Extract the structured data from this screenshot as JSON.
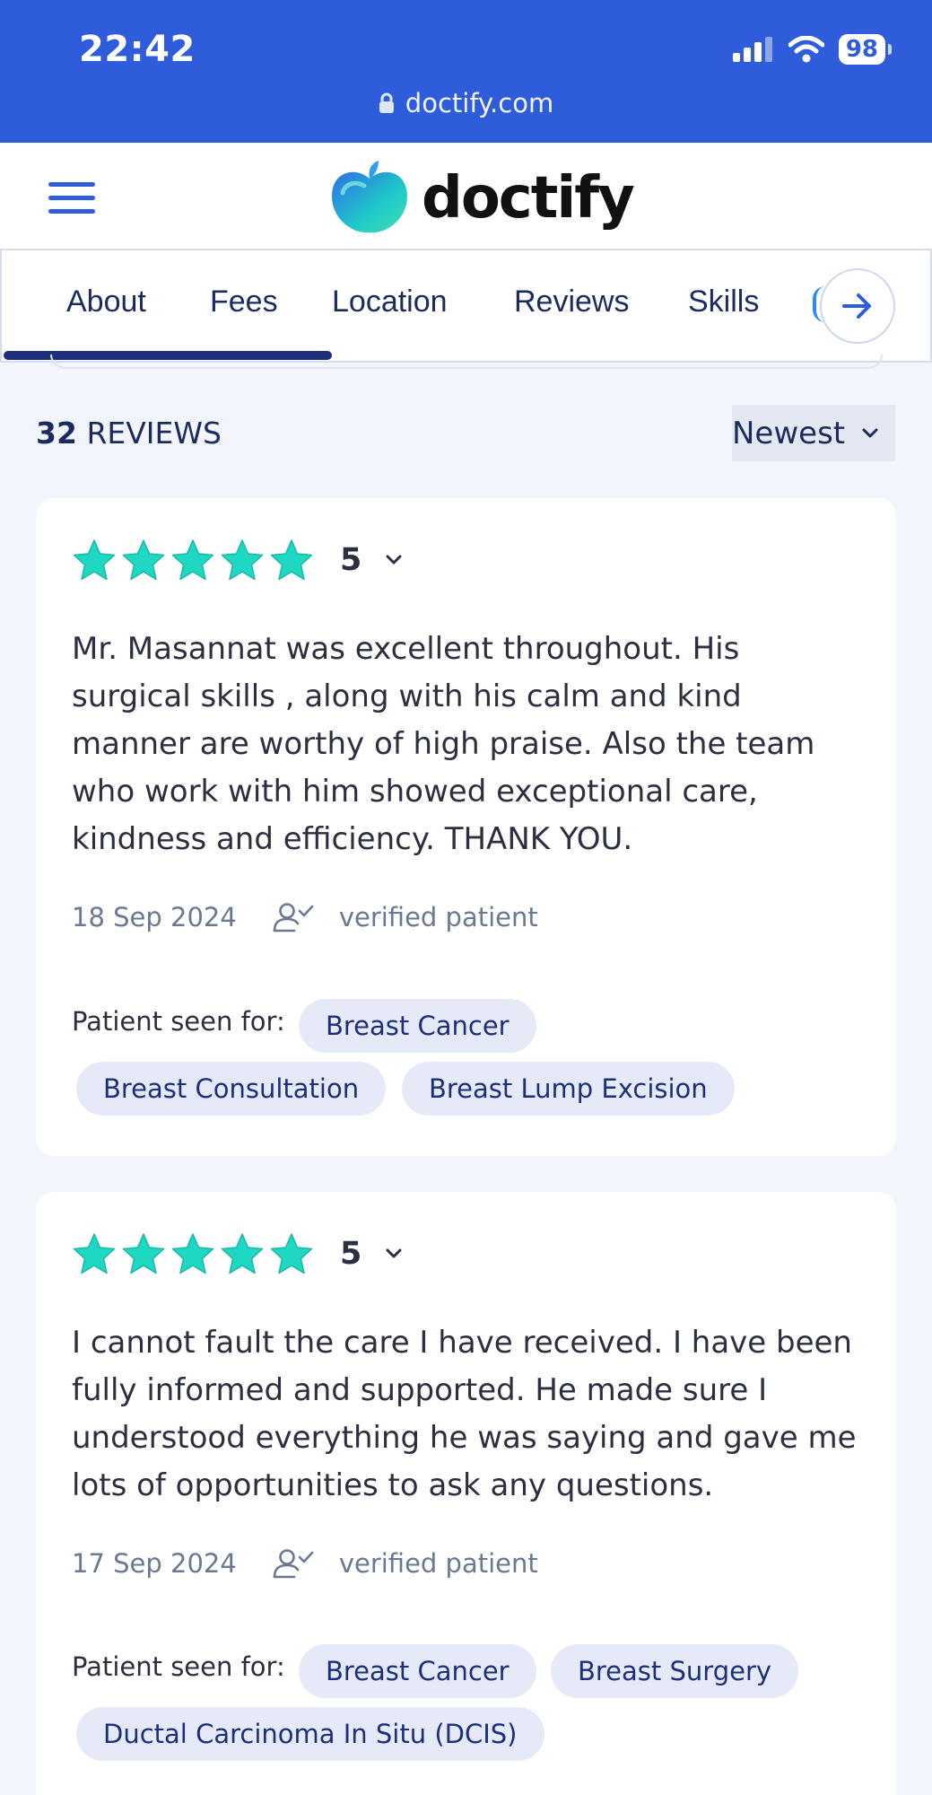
{
  "status_bar": {
    "time": "22:42",
    "battery": "98",
    "url": "doctify.com"
  },
  "header": {
    "brand": "doctify"
  },
  "tabs": [
    {
      "label": "About"
    },
    {
      "label": "Fees"
    },
    {
      "label": "Location"
    },
    {
      "label": "Reviews"
    },
    {
      "label": "Skills"
    }
  ],
  "reviews_header": {
    "count": "32",
    "label": "REVIEWS",
    "sort": "Newest"
  },
  "reviews": [
    {
      "rating": "5",
      "text": "Mr. Masannat was excellent throughout. His surgical skills , along with his calm and kind manner are worthy of high praise. Also the team who work with him showed exceptional care, kindness and efficiency. THANK YOU.",
      "date": "18 Sep 2024",
      "verified": "verified patient",
      "seen_for_label": "Patient seen for:",
      "tags": [
        "Breast Cancer",
        "Breast Consultation",
        "Breast Lump Excision"
      ]
    },
    {
      "rating": "5",
      "text": "I cannot fault the care I have received. I have been fully informed and supported. He made sure I understood everything he was saying and gave me lots of opportunities to ask any questions.",
      "date": "17 Sep 2024",
      "verified": "verified patient",
      "seen_for_label": "Patient seen for:",
      "tags": [
        "Breast Cancer",
        "Breast Surgery",
        "Ductal Carcinoma In Situ (DCIS)"
      ]
    }
  ],
  "colors": {
    "brand_blue": "#2e5cdb",
    "star_teal": "#1fd8c3",
    "navy": "#1c2f7a"
  }
}
